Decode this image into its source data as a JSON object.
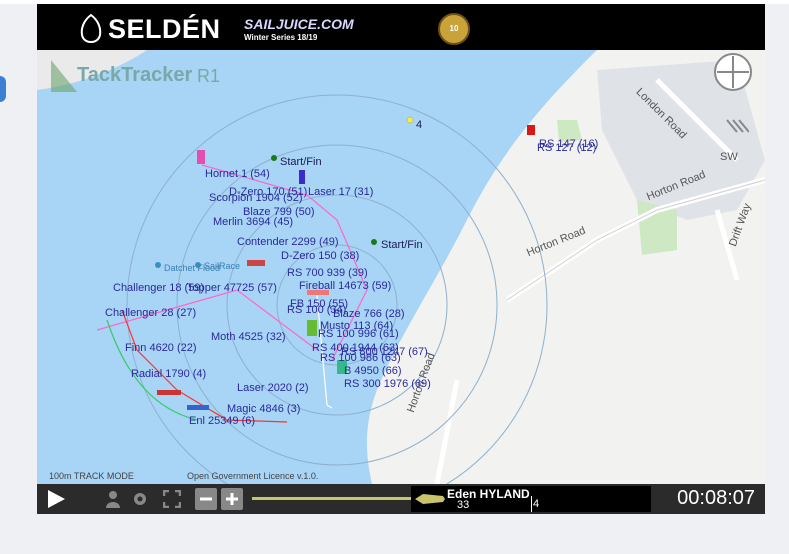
{
  "banner": {
    "brand": "SELDÉN",
    "sponsor": "SAILJUICE.COM",
    "series": "Winter Series 18/19",
    "badge_number": "10"
  },
  "map": {
    "logo": "TackTracker",
    "race": "R1",
    "compass": "SW",
    "roads": [
      "London Road",
      "Horton Road",
      "Horton Road",
      "Drift Way",
      "Horton Road"
    ],
    "marks": [
      "Start/Fin",
      "Start/Fin",
      "4",
      "Datchet Flood",
      "SailRace"
    ],
    "boats": [
      "Hornet 1 (54)",
      "Laser 17 (31)",
      "Scorpion 1904 (52)",
      "D-Zero 170 (51)",
      "Blaze 799 (50)",
      "Merlin 3694 (45)",
      "Contender 2299 (49)",
      "D-Zero 150 (38)",
      "RS 700 939 (39)",
      "Fireball 14673 (59)",
      "Challenger 18 (59)",
      "Topper 47725 (57)",
      "FB 150 (55)",
      "RS 100 (34)",
      "Blaze 766 (28)",
      "Musto 113 (64)",
      "RS 100 996 (61)",
      "Moth 4525 (32)",
      "RS 400 1944 (63)",
      "RS 100 986 (63)",
      "RS 800 1247 (67)",
      "B 4950 (66)",
      "RS 300 1976 (69)",
      "Challenger 28 (27)",
      "Finn 4620 (22)",
      "Radial 1790 (4)",
      "RS 127 (12)",
      "RS 147 (16)",
      "Laser 2020 (2)",
      "Enl 25349 (6)",
      "Magic 4846 (3)"
    ],
    "footer_scale": "100m TRACK MODE",
    "footer_licence": "Open Government Licence v.1.0."
  },
  "controls": {
    "selected_name": "Eden HYLAND",
    "selected_number": "33",
    "selected_position": "4",
    "time": "00:08:07"
  }
}
